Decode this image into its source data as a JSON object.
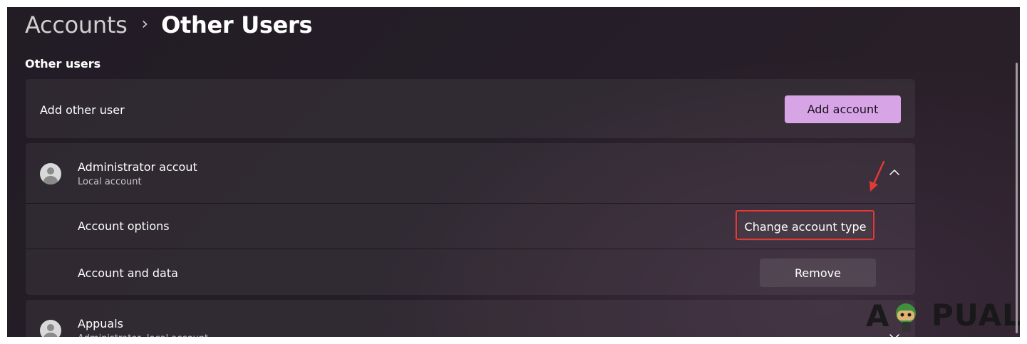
{
  "breadcrumb": {
    "parent": "Accounts",
    "separator": "›",
    "current": "Other Users"
  },
  "section": {
    "title": "Other users"
  },
  "add_user": {
    "label": "Add other user",
    "button": "Add account",
    "accent_color": "#d7a5e6"
  },
  "admin_account": {
    "name": "Administrator accout",
    "type": "Local account",
    "expanded": true,
    "options_label": "Account options",
    "change_type_button": "Change account type",
    "data_label": "Account and data",
    "remove_button": "Remove"
  },
  "appuals_account": {
    "name": "Appuals",
    "type": "Administrator, local account",
    "expanded": false
  },
  "annotations": {
    "highlight_color": "#e53935"
  },
  "watermark": {
    "text": "APPUALS"
  }
}
